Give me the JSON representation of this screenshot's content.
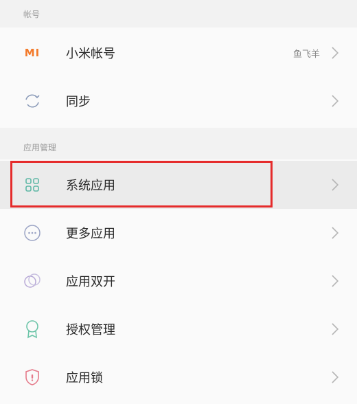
{
  "sections": {
    "account": {
      "header": "帐号",
      "items": [
        {
          "label": "小米帐号",
          "value": "鱼飞羊",
          "icon": "mi-logo-icon"
        },
        {
          "label": "同步",
          "icon": "sync-icon"
        }
      ]
    },
    "app_management": {
      "header": "应用管理",
      "items": [
        {
          "label": "系统应用",
          "icon": "grid-apps-icon"
        },
        {
          "label": "更多应用",
          "icon": "more-dots-icon"
        },
        {
          "label": "应用双开",
          "icon": "dual-circles-icon"
        },
        {
          "label": "授权管理",
          "icon": "badge-icon"
        },
        {
          "label": "应用锁",
          "icon": "shield-lock-icon"
        }
      ]
    }
  },
  "mi_logo_text": "MI",
  "colors": {
    "accent_orange": "#f37a2a",
    "highlight_red": "#e52b2b",
    "icon_teal": "#5fb8a6"
  }
}
